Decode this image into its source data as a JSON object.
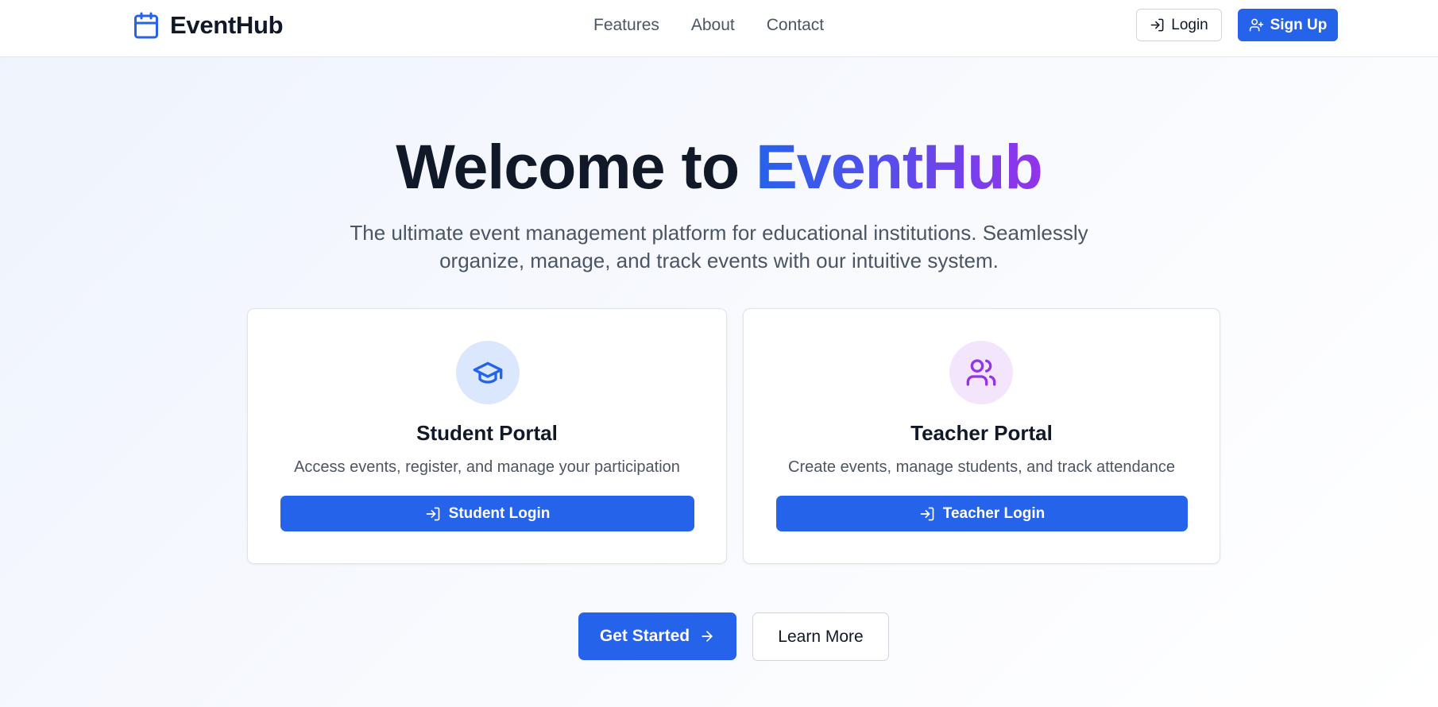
{
  "brand": {
    "name": "EventHub",
    "icon": "calendar-icon",
    "color": "#2563eb"
  },
  "nav": {
    "links": [
      {
        "label": "Features"
      },
      {
        "label": "About"
      },
      {
        "label": "Contact"
      }
    ],
    "login_label": "Login",
    "signup_label": "Sign Up"
  },
  "hero": {
    "title_prefix": "Welcome to",
    "title_brand": "EventHub",
    "subtitle": "The ultimate event management platform for educational institutions. Seamlessly organize, manage, and track events with our intuitive system."
  },
  "portals": {
    "student": {
      "icon": "graduation-cap-icon",
      "title": "Student Portal",
      "description": "Access events, register, and manage your participation",
      "button_label": "Student Login"
    },
    "teacher": {
      "icon": "users-icon",
      "title": "Teacher Portal",
      "description": "Create events, manage students, and track attendance",
      "button_label": "Teacher Login"
    }
  },
  "cta": {
    "get_started_label": "Get Started",
    "learn_more_label": "Learn More"
  },
  "colors": {
    "primary": "#2563eb",
    "accent_purple": "#9333ea",
    "text_dark": "#111827",
    "text_muted": "#4b5563"
  }
}
